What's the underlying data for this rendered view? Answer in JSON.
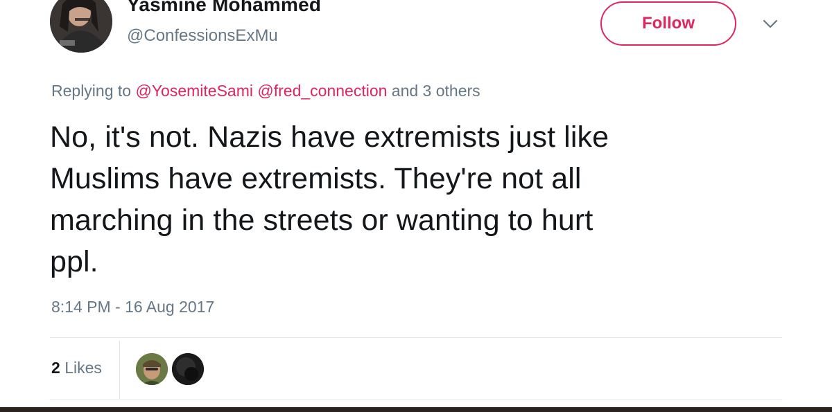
{
  "author": {
    "name": "Yasmine Mohammed",
    "handle": "@ConfessionsExMu"
  },
  "follow_label": "Follow",
  "reply": {
    "prefix": "Replying to",
    "mentions": [
      "@YosemiteSami",
      "@fred_connection"
    ],
    "suffix": "and 3 others"
  },
  "tweet": {
    "lines": [
      "No, it's not. Nazis have extremists just like",
      "Muslims have extremists. They're not all",
      "marching in the streets or wanting to hurt",
      "ppl."
    ]
  },
  "timestamp": "8:14 PM - 16 Aug 2017",
  "stats": {
    "likes_count": "2",
    "likes_label": "Likes"
  },
  "icons": {
    "more": "chevron-down-icon"
  },
  "colors": {
    "accent": "#e0245e",
    "secondary_text": "#657786",
    "primary_text": "#14171a",
    "divider": "#e1e8ed"
  }
}
